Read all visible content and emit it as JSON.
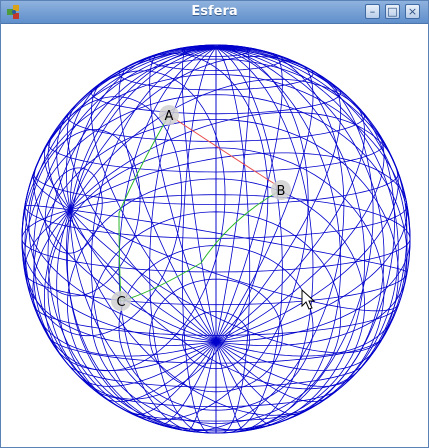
{
  "window": {
    "title": "Esfera",
    "controls": {
      "minimize": "–",
      "maximize": "□",
      "close": "×"
    }
  },
  "sphere": {
    "colors": {
      "mesh": "#0000cc",
      "arc_ab": "#e85050",
      "arc_green": "#2ab82a",
      "point_bg": "#d0d0d0"
    },
    "points": [
      {
        "label": "A"
      },
      {
        "label": "B"
      },
      {
        "label": "C"
      }
    ]
  },
  "cursor": {
    "icon": "arrow-cursor-icon"
  }
}
